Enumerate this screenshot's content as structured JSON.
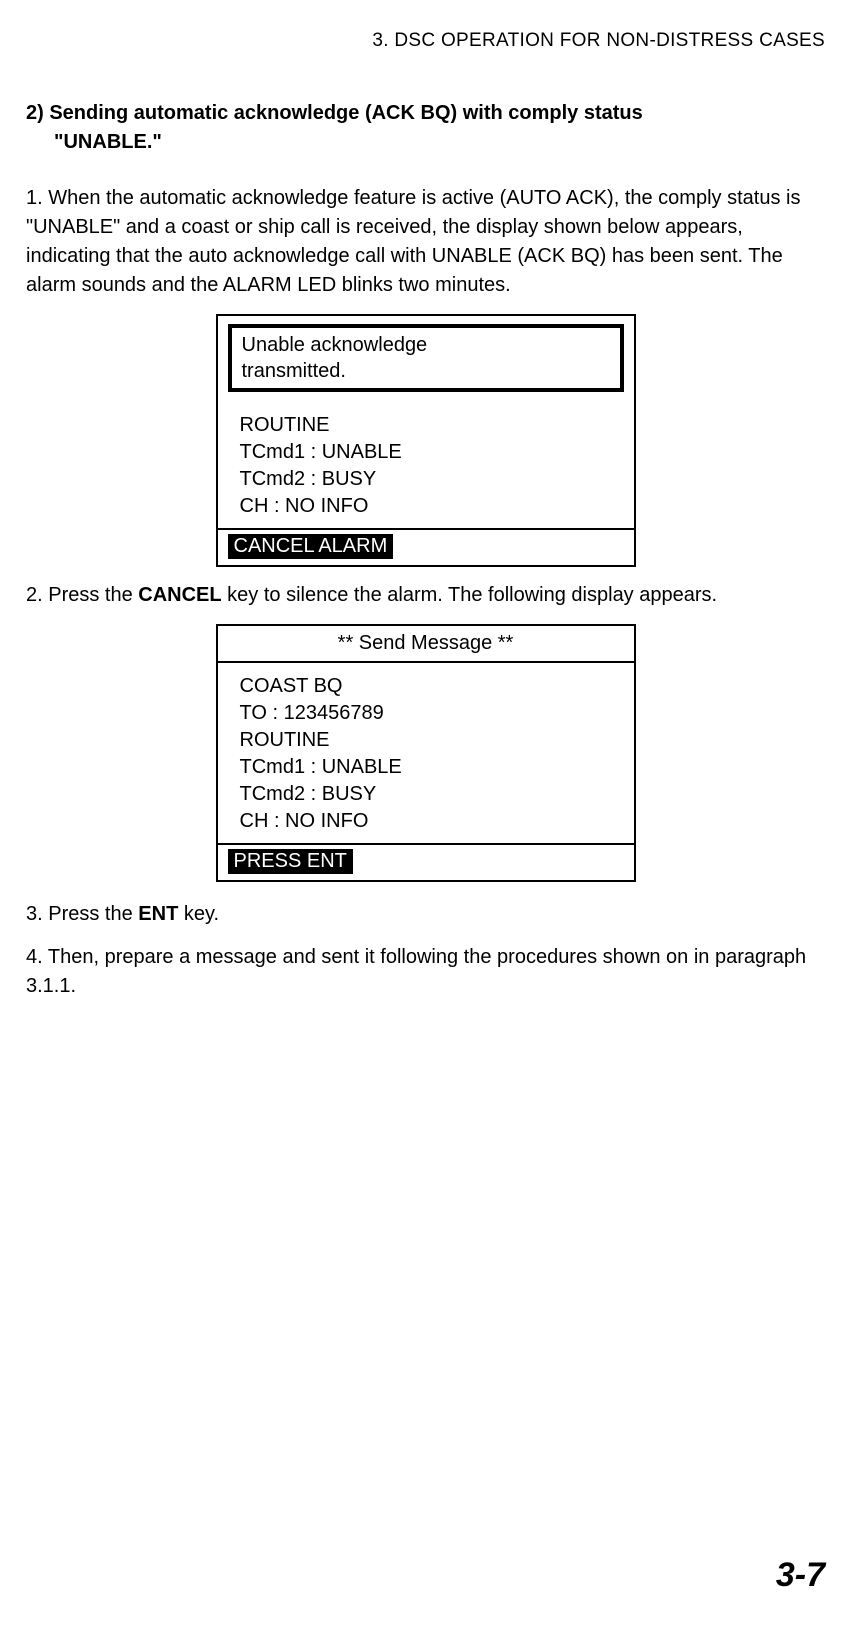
{
  "header": {
    "chapter_title": "3. DSC OPERATION FOR NON-DISTRESS CASES"
  },
  "section": {
    "title": "2) Sending automatic acknowledge (ACK BQ) with comply status",
    "title_sub": "\"UNABLE.\""
  },
  "step1": {
    "prefix": "1. ",
    "text": "When the automatic acknowledge feature is active (AUTO ACK), the comply status is \"UNABLE\" and a coast or ship call is received, the display shown below appears, indicating that the auto acknowledge call with UNABLE (ACK BQ) has been sent. The alarm sounds and the ALARM LED blinks two minutes."
  },
  "display1": {
    "alert_line1": "Unable acknowledge",
    "alert_line2": "transmitted.",
    "line1": "ROUTINE",
    "line2": "TCmd1 : UNABLE",
    "line3": "TCmd2 : BUSY",
    "line4": "CH : NO INFO",
    "footer": "CANCEL ALARM"
  },
  "step2": {
    "prefix": "2. Press the ",
    "cancel_key": "CANCEL",
    "suffix": " key to silence the alarm. The following display appears."
  },
  "display2": {
    "header": "** Send Message **",
    "line1": "COAST BQ",
    "line2": "TO : 123456789",
    "line3": "ROUTINE",
    "line4": "TCmd1 : UNABLE",
    "line5": "TCmd2 : BUSY",
    "line6": "CH : NO INFO",
    "footer": "PRESS ENT"
  },
  "step3": {
    "prefix": "3. Press the ",
    "ent_key": "ENT",
    "suffix": " key."
  },
  "step4": {
    "text": "4. Then, prepare a message and sent it following the procedures shown on in paragraph 3.1.1."
  },
  "page_number": "3-7"
}
